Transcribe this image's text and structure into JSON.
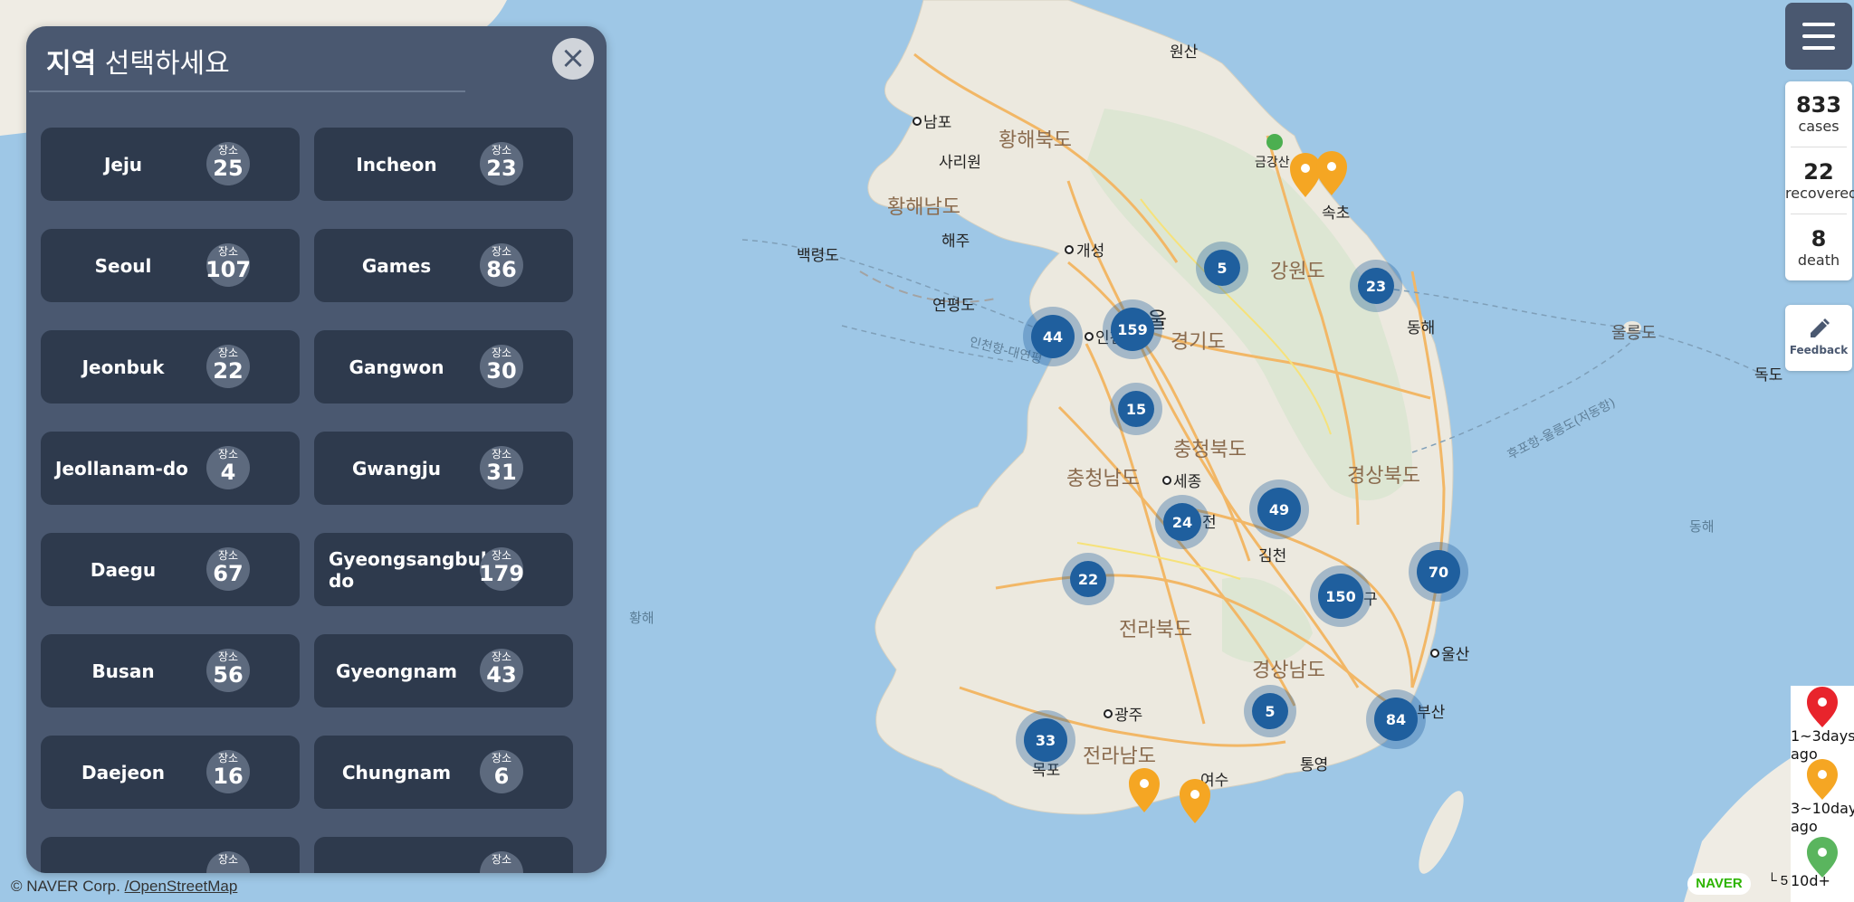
{
  "panel": {
    "title_bold": "지역",
    "title_rest": " 선택하세요",
    "close_label": "×",
    "badge_label": "장소",
    "regions": [
      {
        "name": "Jeju",
        "count": "25"
      },
      {
        "name": "Incheon",
        "count": "23"
      },
      {
        "name": "Seoul",
        "count": "107"
      },
      {
        "name": "Games",
        "count": "86"
      },
      {
        "name": "Jeonbuk",
        "count": "22"
      },
      {
        "name": "Gangwon",
        "count": "30"
      },
      {
        "name": "Jeollanam-do",
        "count": "4"
      },
      {
        "name": "Gwangju",
        "count": "31"
      },
      {
        "name": "Daegu",
        "count": "67"
      },
      {
        "name": "Gyeongsangbuk-do",
        "count": "179"
      },
      {
        "name": "Busan",
        "count": "56"
      },
      {
        "name": "Gyeongnam",
        "count": "43"
      },
      {
        "name": "Daejeon",
        "count": "16"
      },
      {
        "name": "Chungnam",
        "count": "6"
      },
      {
        "name": "",
        "count": ""
      },
      {
        "name": "",
        "count": ""
      }
    ]
  },
  "stats": {
    "cases": {
      "value": "833",
      "label": "cases"
    },
    "recovered": {
      "value": "22",
      "label": "recovered"
    },
    "death": {
      "value": "8",
      "label": "death"
    }
  },
  "feedback_label": "Feedback",
  "legend": [
    {
      "label": "1~3days ago",
      "color": "#e8242c"
    },
    {
      "label": "3~10days ago",
      "color": "#f5a623"
    },
    {
      "label": "10d+",
      "color": "#5ab55e"
    }
  ],
  "map": {
    "provinces": [
      "황해북도",
      "황해남도",
      "강원도",
      "경기도",
      "충청북도",
      "충청남도",
      "경상북도",
      "전라북도",
      "경상남도",
      "전라남도"
    ],
    "cities": [
      "원산",
      "남포",
      "사리원",
      "금강산",
      "속초",
      "해주",
      "개성",
      "백령도",
      "연평도",
      "인천",
      "울",
      "동해",
      "울릉도",
      "독도",
      "세종",
      "전",
      "김천",
      "구",
      "울산",
      "광주",
      "부산",
      "목포",
      "여수",
      "통영"
    ],
    "seas": [
      "황해",
      "동해"
    ],
    "routes": [
      "인천항-대연평",
      "후포항-울릉도(저동항)"
    ],
    "clusters": [
      "5",
      "23",
      "159",
      "44",
      "15",
      "49",
      "24",
      "22",
      "70",
      "150",
      "5",
      "84",
      "33"
    ],
    "marker_color": "#f5a623",
    "cluster_color": "#1f5f9e"
  },
  "attribution": {
    "naver": "© NAVER Corp.",
    "osm": "/OpenStreetMap",
    "logo": "NAVER",
    "scale": "5"
  }
}
